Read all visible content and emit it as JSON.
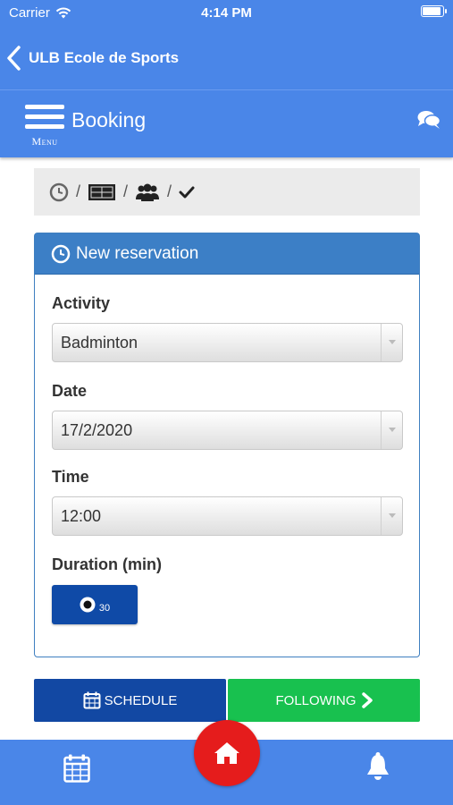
{
  "status_bar": {
    "carrier": "Carrier",
    "time": "4:14 PM",
    "battery_level": 1.0
  },
  "nav": {
    "back_label": "ULB Ecole de Sports"
  },
  "header": {
    "menu_label": "Menu",
    "title": "Booking"
  },
  "breadcrumb": {
    "separator": "/",
    "steps": [
      "clock-icon",
      "court-icon",
      "group-icon",
      "check-icon"
    ]
  },
  "panel": {
    "title": "New reservation",
    "activity": {
      "label": "Activity",
      "value": "Badminton"
    },
    "date": {
      "label": "Date",
      "value": "17/2/2020"
    },
    "time": {
      "label": "Time",
      "value": "12:00"
    },
    "duration": {
      "label": "Duration (min)",
      "value": "30"
    }
  },
  "buttons": {
    "schedule": "SCHEDULE",
    "following": "FOLLOWING"
  },
  "tab_bar": {
    "items": [
      "calendar-icon",
      "home-icon",
      "bell-icon"
    ]
  },
  "colors": {
    "primary": "#4a86e8",
    "panel_header": "#3c7fc6",
    "schedule_button": "#1248a3",
    "following_button": "#18c14f",
    "home_button": "#e51c1c"
  }
}
